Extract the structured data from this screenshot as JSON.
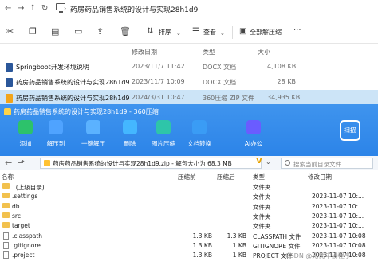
{
  "explorer": {
    "path": "药房药品销售系统的设计与实现28h1d9",
    "toolbar": {
      "sort_label": "排序",
      "view_label": "查看",
      "extract_all_label": "全部解压缩"
    },
    "columns": {
      "date": "修改日期",
      "type": "类型",
      "size": "大小"
    },
    "files": [
      {
        "name": "Springboot开发环境说明",
        "date": "2023/11/7 11:42",
        "type": "DOCX 文档",
        "size": "4,108 KB",
        "icon_color": "#2b579a",
        "selected": false
      },
      {
        "name": "药房药品销售系统的设计与实现28h1d9",
        "date": "2023/11/7 10:09",
        "type": "DOCX 文档",
        "size": "28 KB",
        "icon_color": "#2b579a",
        "selected": false
      },
      {
        "name": "药房药品销售系统的设计与实现28h1d9",
        "date": "2024/3/31 10:47",
        "type": "360压缩 ZIP 文件",
        "size": "34,935 KB",
        "icon_color": "#f2a51b",
        "selected": true
      }
    ]
  },
  "zip_window": {
    "title": "药房药品销售系统的设计与实现28h1d9 - 360压缩",
    "scan_label": "扫描",
    "tools": [
      {
        "label": "添加",
        "icon": "add-icon",
        "color": "#2dc26b"
      },
      {
        "label": "解压到",
        "icon": "extract-to-icon",
        "color": "#4fa3ff"
      },
      {
        "label": "一键解压",
        "icon": "one-click-extract-icon",
        "color": "#5bb2ff"
      },
      {
        "label": "删除",
        "icon": "delete-icon",
        "color": "#44b7ff"
      },
      {
        "label": "图片压缩",
        "icon": "image-compress-icon",
        "color": "#2ec5a9"
      },
      {
        "label": "文档转换",
        "icon": "doc-convert-icon",
        "color": "#3a9cf5"
      },
      {
        "label": "AI办公",
        "icon": "ai-office-icon",
        "color": "#6a5cff"
      }
    ],
    "address": "药房药品销售系统的设计与实现28h1d9.zip - 解包大小为 68.3 MB",
    "search_placeholder": "搜索当前目录文件",
    "columns": {
      "name": "名称",
      "compressed": "压缩前",
      "after": "压缩后",
      "type": "类型",
      "modified": "修改日期"
    },
    "rows": [
      {
        "name": "..(上级目录)",
        "compressed": "",
        "after": "",
        "type": "文件夹",
        "modified": "",
        "kind": "up"
      },
      {
        "name": ".settings",
        "compressed": "",
        "after": "",
        "type": "文件夹",
        "modified": "2023-11-07 10:...",
        "kind": "folder"
      },
      {
        "name": "db",
        "compressed": "",
        "after": "",
        "type": "文件夹",
        "modified": "2023-11-07 10:...",
        "kind": "folder"
      },
      {
        "name": "src",
        "compressed": "",
        "after": "",
        "type": "文件夹",
        "modified": "2023-11-07 10:...",
        "kind": "folder"
      },
      {
        "name": "target",
        "compressed": "",
        "after": "",
        "type": "文件夹",
        "modified": "2023-11-07 10:...",
        "kind": "folder"
      },
      {
        "name": ".classpath",
        "compressed": "1.3 KB",
        "after": "1.3 KB",
        "type": "CLASSPATH 文件",
        "modified": "2023-11-07 10:08",
        "kind": "file"
      },
      {
        "name": ".gitignore",
        "compressed": "1.3 KB",
        "after": "1 KB",
        "type": "GITIGNORE 文件",
        "modified": "2023-11-07 10:08",
        "kind": "file"
      },
      {
        "name": ".project",
        "compressed": "1.3 KB",
        "after": "1 KB",
        "type": "PROJECT 文件",
        "modified": "2023-11-07 10:08",
        "kind": "file"
      }
    ]
  },
  "watermark": "CSDN @无忧毕设程序"
}
